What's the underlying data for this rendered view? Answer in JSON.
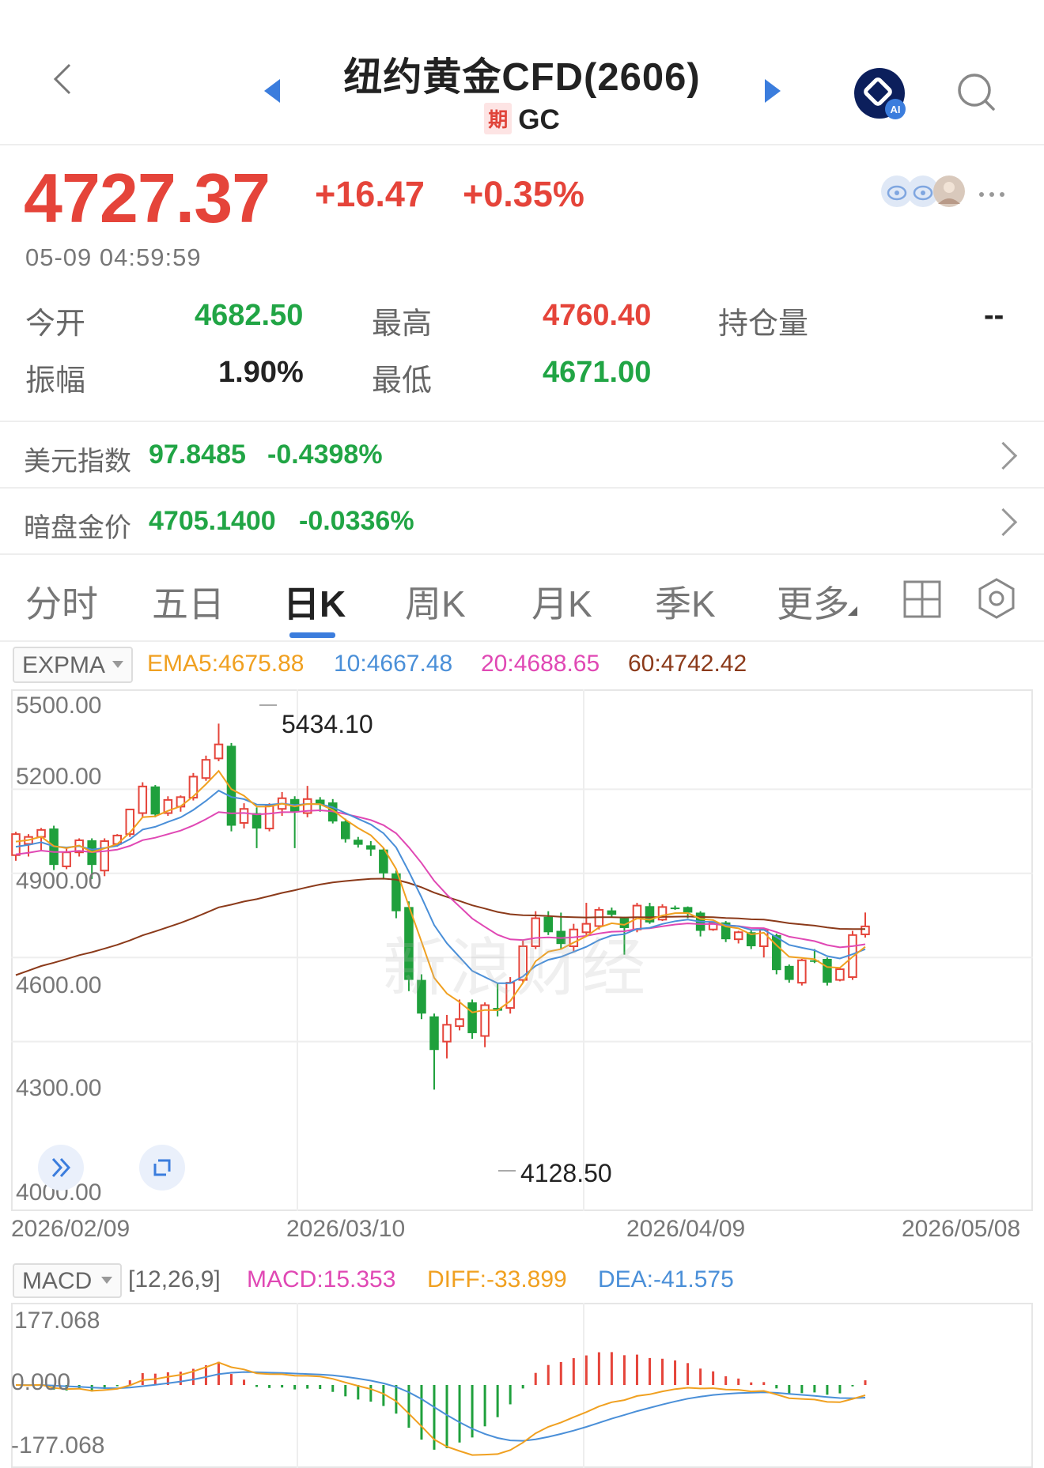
{
  "header": {
    "title": "纽约黄金CFD(2606)",
    "badge": "期",
    "code": "GC"
  },
  "quote": {
    "price": "4727.37",
    "change": "+16.47",
    "change_pct": "+0.35%",
    "time": "05-09 04:59:59"
  },
  "stats": {
    "open_label": "今开",
    "open": "4682.50",
    "high_label": "最高",
    "high": "4760.40",
    "oi_label": "持仓量",
    "oi": "--",
    "amp_label": "振幅",
    "amp": "1.90%",
    "low_label": "最低",
    "low": "4671.00"
  },
  "related": [
    {
      "label": "美元指数",
      "value": "97.8485",
      "pct": "-0.4398%"
    },
    {
      "label": "暗盘金价",
      "value": "4705.1400",
      "pct": "-0.0336%"
    }
  ],
  "tabs": [
    "分时",
    "五日",
    "日K",
    "周K",
    "月K",
    "季K",
    "更多"
  ],
  "active_tab": 2,
  "expma": {
    "selector": "EXPMA",
    "ema5": "EMA5:4675.88",
    "ema10": "10:4667.48",
    "ema20": "20:4688.65",
    "ema60": "60:4742.42"
  },
  "chart_labels": {
    "y_ticks": [
      "5500.00",
      "5200.00",
      "4900.00",
      "4600.00",
      "4300.00",
      "4000.00"
    ],
    "x_ticks": [
      "2026/02/09",
      "2026/03/10",
      "2026/04/09",
      "2026/05/08"
    ],
    "max_label": "5434.10",
    "min_label": "4128.50",
    "watermark": "新浪财经"
  },
  "macd": {
    "selector": "MACD",
    "params": "[12,26,9]",
    "macd": "MACD:15.353",
    "diff": "DIFF:-33.899",
    "dea": "DEA:-41.575",
    "y_ticks": [
      "177.068",
      "0.000",
      "-177.068"
    ]
  },
  "colors": {
    "up": "#e5443a",
    "down": "#1fa03c",
    "ema5": "#f0a020",
    "ema10": "#4a8fd8",
    "ema20": "#e048b4",
    "ema60": "#8b3a1a",
    "accent": "#3b7ddd"
  },
  "icons": [
    "back-icon",
    "prev-arrow-icon",
    "next-arrow-icon",
    "ai-icon",
    "search-icon",
    "weibo-icon",
    "more-icon",
    "grid-icon",
    "settings-icon",
    "forward-icon",
    "fullscreen-icon"
  ],
  "chart_data": {
    "type": "candlestick",
    "x_range": [
      "2026/02/09",
      "2026/05/08"
    ],
    "ylim": [
      4000,
      5500
    ],
    "candles": [
      [
        4965,
        5040,
        4945,
        5048
      ],
      [
        5005,
        5030,
        4960,
        5040
      ],
      [
        5030,
        5055,
        4980,
        5062
      ],
      [
        5060,
        4930,
        4912,
        5070
      ],
      [
        4925,
        4975,
        4915,
        4990
      ],
      [
        4975,
        5018,
        4960,
        5025
      ],
      [
        5018,
        4930,
        4880,
        5025
      ],
      [
        4910,
        5015,
        4890,
        5025
      ],
      [
        5005,
        5035,
        4995,
        5040
      ],
      [
        5040,
        5128,
        5030,
        5128
      ],
      [
        5115,
        5210,
        5100,
        5225
      ],
      [
        5210,
        5110,
        5100,
        5215
      ],
      [
        5115,
        5162,
        5105,
        5175
      ],
      [
        5138,
        5172,
        5120,
        5178
      ],
      [
        5170,
        5245,
        5160,
        5258
      ],
      [
        5240,
        5305,
        5230,
        5320
      ],
      [
        5310,
        5360,
        5300,
        5434.1
      ],
      [
        5355,
        5070,
        5050,
        5365
      ],
      [
        5080,
        5130,
        5060,
        5150
      ],
      [
        5115,
        5060,
        4990,
        5135
      ],
      [
        5060,
        5140,
        5050,
        5150
      ],
      [
        5130,
        5168,
        5105,
        5190
      ],
      [
        5165,
        5120,
        4990,
        5175
      ],
      [
        5115,
        5165,
        5100,
        5212
      ],
      [
        5163,
        5145,
        5120,
        5172
      ],
      [
        5153,
        5085,
        5078,
        5165
      ],
      [
        5085,
        5022,
        5010,
        5095
      ],
      [
        5020,
        5002,
        4992,
        5030
      ],
      [
        5000,
        4985,
        4962,
        5015
      ],
      [
        4985,
        4900,
        4880,
        4990
      ],
      [
        4900,
        4765,
        4740,
        4910
      ],
      [
        4780,
        4520,
        4480,
        4800
      ],
      [
        4520,
        4400,
        4380,
        4540
      ],
      [
        4390,
        4270,
        4128.5,
        4400
      ],
      [
        4300,
        4360,
        4240,
        4395
      ],
      [
        4355,
        4380,
        4340,
        4450
      ],
      [
        4440,
        4330,
        4310,
        4450
      ],
      [
        4320,
        4430,
        4280,
        4440
      ],
      [
        4420,
        4410,
        4390,
        4510
      ],
      [
        4420,
        4510,
        4400,
        4530
      ],
      [
        4520,
        4640,
        4510,
        4660
      ],
      [
        4640,
        4740,
        4630,
        4765
      ],
      [
        4745,
        4690,
        4680,
        4765
      ],
      [
        4695,
        4648,
        4630,
        4760
      ],
      [
        4640,
        4700,
        4620,
        4720
      ],
      [
        4690,
        4720,
        4680,
        4795
      ],
      [
        4712,
        4770,
        4700,
        4780
      ],
      [
        4768,
        4752,
        4742,
        4778
      ],
      [
        4740,
        4705,
        4610,
        4745
      ],
      [
        4700,
        4785,
        4690,
        4795
      ],
      [
        4783,
        4725,
        4720,
        4795
      ],
      [
        4735,
        4780,
        4730,
        4790
      ],
      [
        4778,
        4775,
        4770,
        4785
      ],
      [
        4780,
        4760,
        4740,
        4782
      ],
      [
        4760,
        4695,
        4675,
        4765
      ],
      [
        4700,
        4725,
        4695,
        4728
      ],
      [
        4725,
        4665,
        4655,
        4730
      ],
      [
        4665,
        4690,
        4650,
        4695
      ],
      [
        4690,
        4640,
        4630,
        4698
      ],
      [
        4640,
        4700,
        4600,
        4702
      ],
      [
        4680,
        4555,
        4540,
        4685
      ],
      [
        4570,
        4520,
        4510,
        4575
      ],
      [
        4510,
        4590,
        4500,
        4595
      ],
      [
        4590,
        4585,
        4580,
        4630
      ],
      [
        4595,
        4510,
        4500,
        4600
      ],
      [
        4520,
        4558,
        4515,
        4565
      ],
      [
        4530,
        4680,
        4520,
        4695
      ],
      [
        4682.5,
        4710.9,
        4671,
        4760.4
      ]
    ]
  }
}
